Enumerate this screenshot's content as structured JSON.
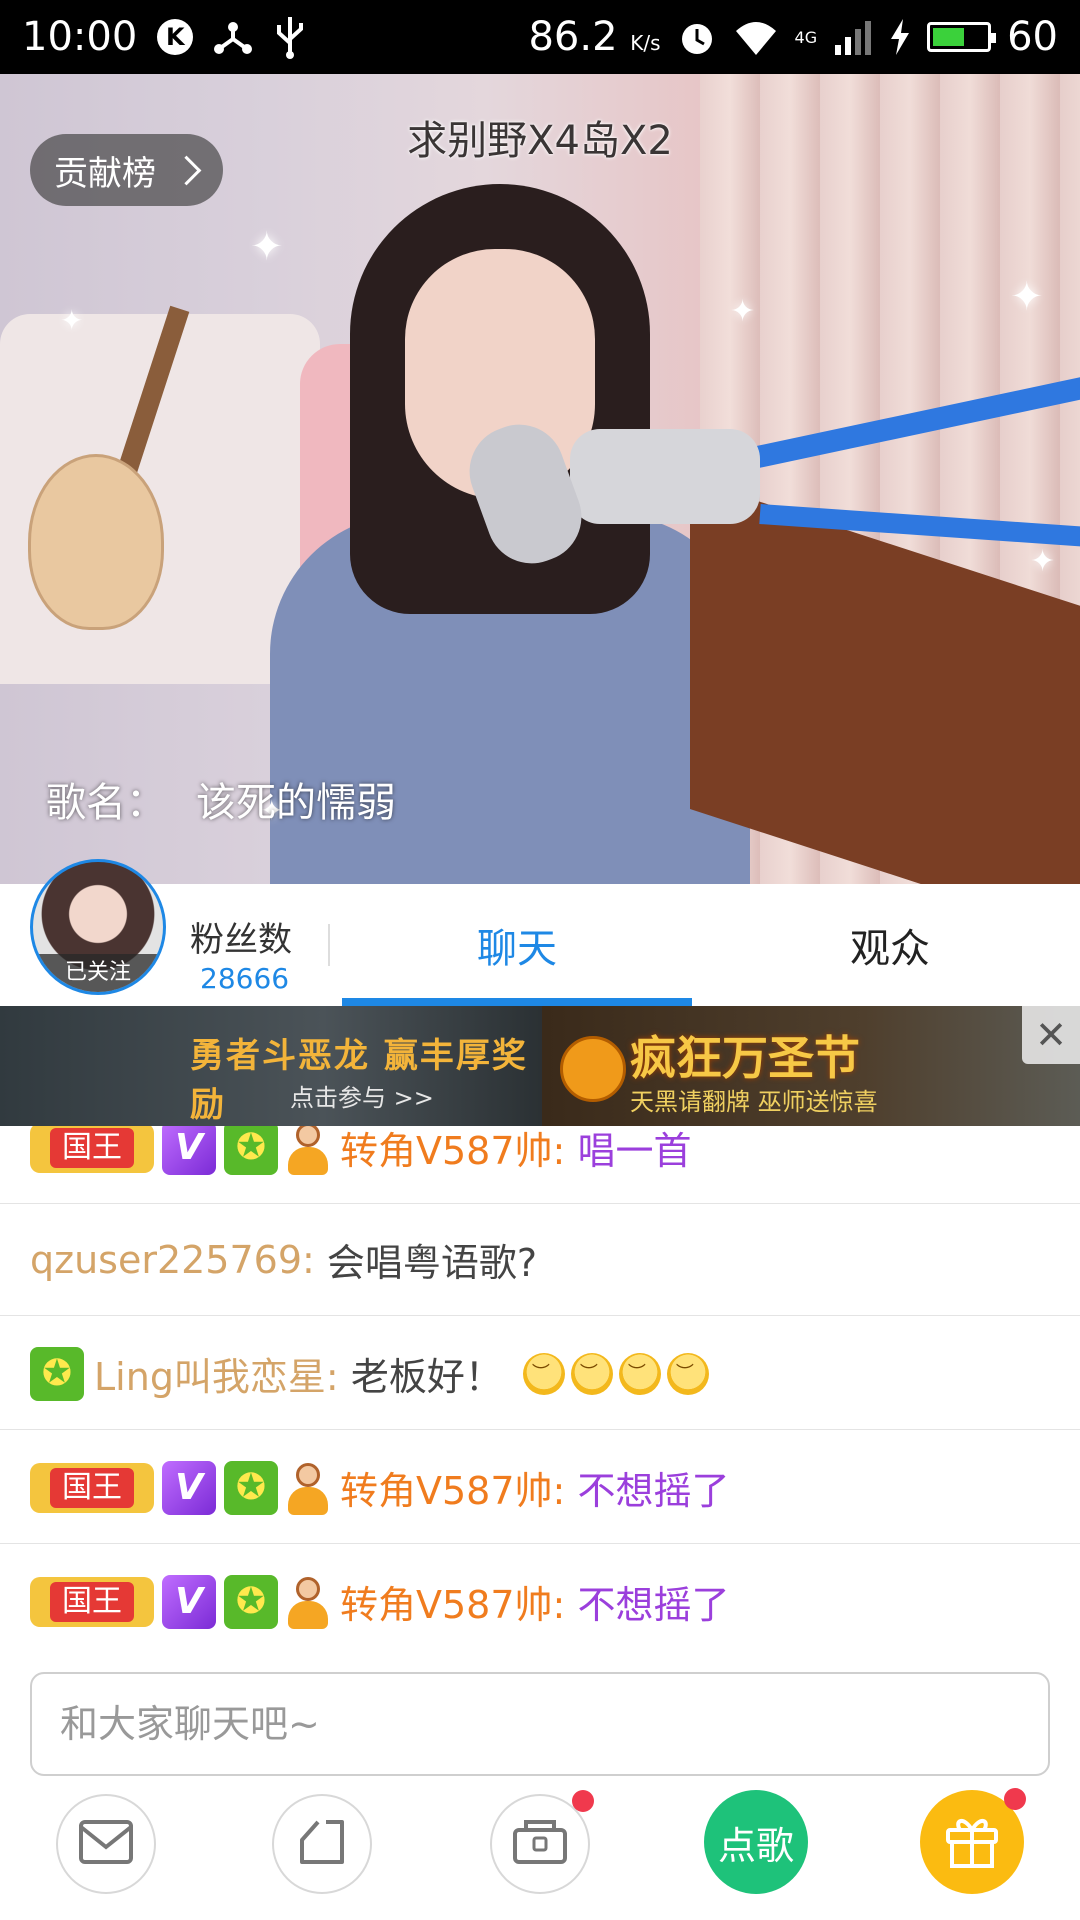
{
  "status_bar": {
    "time": "10:00",
    "k_badge": "K",
    "net_speed": "86.2",
    "net_unit": "K/s",
    "network_type": "4G",
    "battery_level": 0.6,
    "battery_text": "60"
  },
  "video": {
    "overlay_title": "求别野X4岛X2",
    "rank_button_label": "贡献榜",
    "song_label": "歌名：",
    "song_name": "该死的懦弱"
  },
  "host": {
    "follow_status": "已关注",
    "fans_label": "粉丝数",
    "fans_count": "28666"
  },
  "tabs": [
    {
      "label": "聊天",
      "active": true
    },
    {
      "label": "观众",
      "active": false
    }
  ],
  "banner": {
    "left_title": "勇者斗恶龙  赢丰厚奖励",
    "left_cta": "点击参与 >>",
    "right_title": "疯狂万圣节",
    "right_subtitle": "天黑请翻牌 巫师送惊喜"
  },
  "chat": {
    "badge_king_label": "国王",
    "badge_v_label": "V",
    "messages": [
      {
        "badges": [
          "king",
          "v",
          "star",
          "user"
        ],
        "user": "转角V587帅:",
        "text": "唱一首",
        "user_color": "orange",
        "text_color": "purple"
      },
      {
        "badges": [],
        "user": "qzuser225769:",
        "text": "会唱粤语歌?",
        "user_color": "tan",
        "text_color": "gray"
      },
      {
        "badges": [
          "star"
        ],
        "user": "Ling叫我恋星:",
        "text": "老板好！",
        "emoji_count": 4,
        "user_color": "tan",
        "text_color": "gray"
      },
      {
        "badges": [
          "king",
          "v",
          "star",
          "user"
        ],
        "user": "转角V587帅:",
        "text": "不想摇了",
        "user_color": "orange",
        "text_color": "purple"
      },
      {
        "badges": [
          "king",
          "v",
          "star",
          "user"
        ],
        "user": "转角V587帅:",
        "text": "不想摇了",
        "user_color": "orange",
        "text_color": "purple"
      }
    ]
  },
  "input": {
    "placeholder": "和大家聊天吧~",
    "value": ""
  },
  "bottom_bar": {
    "song_button_label": "点歌",
    "icons": [
      "message-icon",
      "share-icon",
      "treasure-chest-icon",
      "gift-icon"
    ]
  },
  "colors": {
    "accent": "#1e88e5",
    "username_orange": "#f07c1e",
    "username_tan": "#d4a468",
    "message_purple": "#9b3fdc",
    "song_button": "#1ec27a",
    "gift_button": "#fbbb11",
    "notification_dot": "#f0394d"
  }
}
